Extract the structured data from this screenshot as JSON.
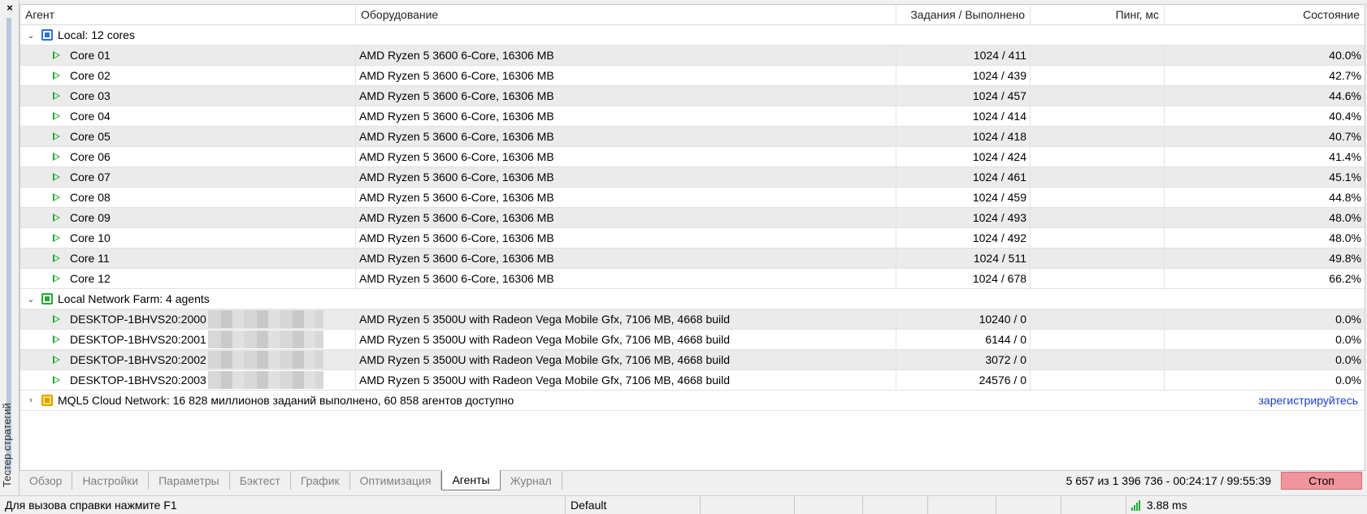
{
  "side_panel": {
    "title": "Тестер стратегий",
    "close_glyph": "×"
  },
  "columns": {
    "agent": "Агент",
    "hardware": "Оборудование",
    "tasks": "Задания / Выполнено",
    "ping": "Пинг, мс",
    "state": "Состояние"
  },
  "groups": {
    "local": {
      "label": "Local: 12 cores",
      "rows": [
        {
          "agent": "Core 01",
          "hardware": "AMD Ryzen 5 3600 6-Core, 16306 MB",
          "tasks": "1024 / 411",
          "ping": "",
          "state": "40.0%"
        },
        {
          "agent": "Core 02",
          "hardware": "AMD Ryzen 5 3600 6-Core, 16306 MB",
          "tasks": "1024 / 439",
          "ping": "",
          "state": "42.7%"
        },
        {
          "agent": "Core 03",
          "hardware": "AMD Ryzen 5 3600 6-Core, 16306 MB",
          "tasks": "1024 / 457",
          "ping": "",
          "state": "44.6%"
        },
        {
          "agent": "Core 04",
          "hardware": "AMD Ryzen 5 3600 6-Core, 16306 MB",
          "tasks": "1024 / 414",
          "ping": "",
          "state": "40.4%"
        },
        {
          "agent": "Core 05",
          "hardware": "AMD Ryzen 5 3600 6-Core, 16306 MB",
          "tasks": "1024 / 418",
          "ping": "",
          "state": "40.7%"
        },
        {
          "agent": "Core 06",
          "hardware": "AMD Ryzen 5 3600 6-Core, 16306 MB",
          "tasks": "1024 / 424",
          "ping": "",
          "state": "41.4%"
        },
        {
          "agent": "Core 07",
          "hardware": "AMD Ryzen 5 3600 6-Core, 16306 MB",
          "tasks": "1024 / 461",
          "ping": "",
          "state": "45.1%"
        },
        {
          "agent": "Core 08",
          "hardware": "AMD Ryzen 5 3600 6-Core, 16306 MB",
          "tasks": "1024 / 459",
          "ping": "",
          "state": "44.8%"
        },
        {
          "agent": "Core 09",
          "hardware": "AMD Ryzen 5 3600 6-Core, 16306 MB",
          "tasks": "1024 / 493",
          "ping": "",
          "state": "48.0%"
        },
        {
          "agent": "Core 10",
          "hardware": "AMD Ryzen 5 3600 6-Core, 16306 MB",
          "tasks": "1024 / 492",
          "ping": "",
          "state": "48.0%"
        },
        {
          "agent": "Core 11",
          "hardware": "AMD Ryzen 5 3600 6-Core, 16306 MB",
          "tasks": "1024 / 511",
          "ping": "",
          "state": "49.8%"
        },
        {
          "agent": "Core 12",
          "hardware": "AMD Ryzen 5 3600 6-Core, 16306 MB",
          "tasks": "1024 / 678",
          "ping": "",
          "state": "66.2%"
        }
      ]
    },
    "farm": {
      "label": "Local Network Farm: 4 agents",
      "rows": [
        {
          "agent": "DESKTOP-1BHVS20:2000",
          "hardware": "AMD Ryzen 5 3500U with Radeon Vega Mobile Gfx, 7106 MB, 4668 build",
          "tasks": "10240 / 0",
          "ping": "",
          "state": "0.0%"
        },
        {
          "agent": "DESKTOP-1BHVS20:2001",
          "hardware": "AMD Ryzen 5 3500U with Radeon Vega Mobile Gfx, 7106 MB, 4668 build",
          "tasks": "6144 / 0",
          "ping": "",
          "state": "0.0%"
        },
        {
          "agent": "DESKTOP-1BHVS20:2002",
          "hardware": "AMD Ryzen 5 3500U with Radeon Vega Mobile Gfx, 7106 MB, 4668 build",
          "tasks": "3072 / 0",
          "ping": "",
          "state": "0.0%"
        },
        {
          "agent": "DESKTOP-1BHVS20:2003",
          "hardware": "AMD Ryzen 5 3500U with Radeon Vega Mobile Gfx, 7106 MB, 4668 build",
          "tasks": "24576 / 0",
          "ping": "",
          "state": "0.0%"
        }
      ]
    },
    "cloud": {
      "label": "MQL5 Cloud Network: 16 828 миллионов заданий выполнено, 60 858 агентов доступно",
      "link": "зарегистрируйтесь"
    }
  },
  "tabs": [
    "Обзор",
    "Настройки",
    "Параметры",
    "Бэктест",
    "График",
    "Оптимизация",
    "Агенты",
    "Журнал"
  ],
  "active_tab": "Агенты",
  "progress": "5 657 из 1 396 736  -  00:24:17 / 99:55:39",
  "stop_label": "Стоп",
  "status_bar": {
    "help": "Для вызова справки нажмите F1",
    "profile": "Default",
    "ping": "3.88 ms"
  },
  "colors": {
    "accent_green": "#22aa33",
    "stop_bg": "#f1959c",
    "link": "#1a3dd1",
    "cpu_blue": "#2a6fdb"
  }
}
